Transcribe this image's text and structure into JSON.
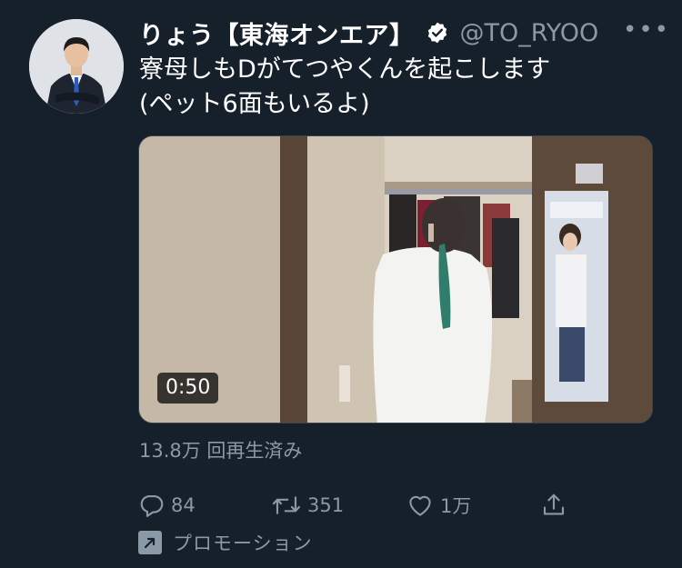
{
  "author": {
    "display_name": "りょう【東海オンエア】",
    "handle": "@TO_RYOO",
    "verified": true
  },
  "tweet": {
    "text_line_1": "寮母しもDがてつやくんを起こします",
    "text_line_2": "(ペット6面もいるよ)"
  },
  "media": {
    "type": "video",
    "duration": "0:50"
  },
  "stats": {
    "views": "13.8万 回再生済み"
  },
  "actions": {
    "reply_count": "84",
    "retweet_count": "351",
    "like_count": "1万"
  },
  "promotion": {
    "label": "プロモーション"
  },
  "icons": {
    "more": "more-icon",
    "verified": "verified-badge-icon",
    "reply": "reply-icon",
    "retweet": "retweet-icon",
    "like": "like-icon",
    "share": "share-icon",
    "promoted": "promoted-icon"
  },
  "colors": {
    "background": "#15202b",
    "secondary_text": "#8b98a5",
    "primary_text": "#ffffff"
  }
}
